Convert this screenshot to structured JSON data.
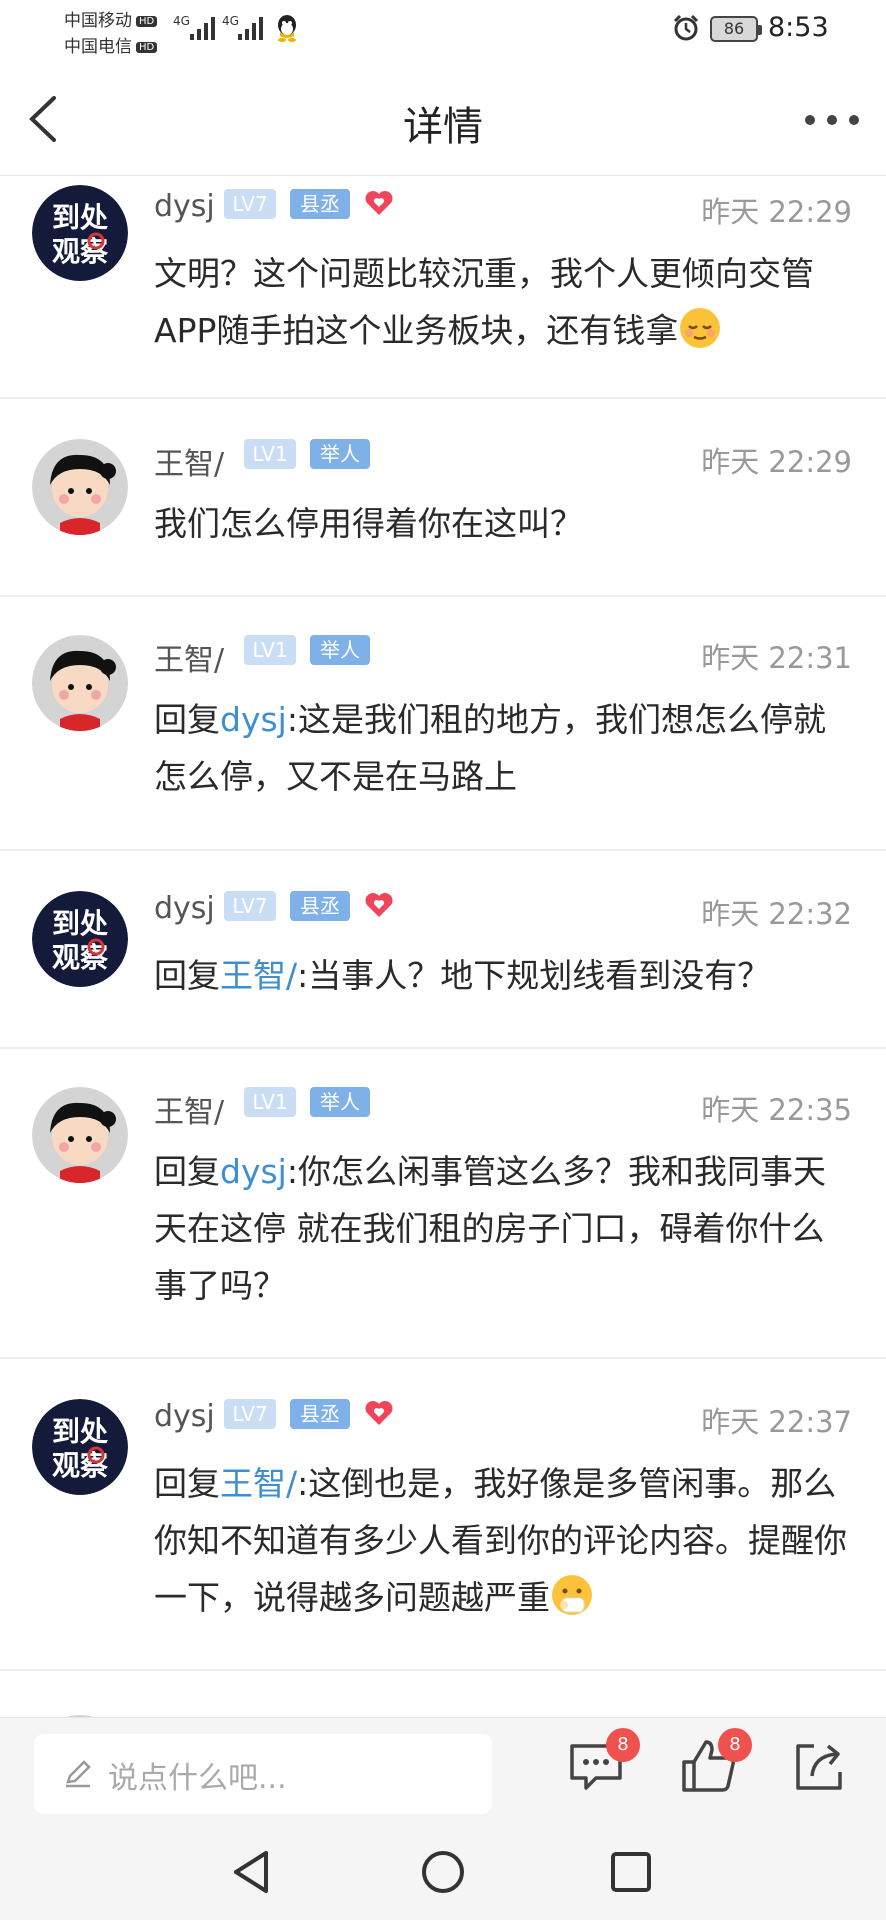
{
  "status": {
    "carrier1": "中国移动",
    "carrier2": "中国电信",
    "hd": "HD",
    "net1": "4G",
    "net2": "4G",
    "battery": "86",
    "time": "8:53"
  },
  "nav": {
    "title": "详情",
    "back_icon": "chevron-left-icon",
    "more_icon": "more-dots-icon"
  },
  "comments": [
    {
      "user": "dysj",
      "level": "LV7",
      "role": "县丞",
      "heart": true,
      "time": "昨天 22:29",
      "reply_prefix": "",
      "mention": "",
      "text": "文明？这个问题比较沉重，我个人更倾向交管APP随手拍这个业务板块，还有钱拿",
      "emoji": "relieved-face"
    },
    {
      "user": "王智/",
      "level": "LV1",
      "role": "举人",
      "heart": false,
      "time": "昨天 22:29",
      "reply_prefix": "",
      "mention": "",
      "text": "我们怎么停用得着你在这叫？",
      "emoji": ""
    },
    {
      "user": "王智/",
      "level": "LV1",
      "role": "举人",
      "heart": false,
      "time": "昨天 22:31",
      "reply_prefix": "回复",
      "mention": "dysj",
      "text": ":这是我们租的地方，我们想怎么停就怎么停，又不是在马路上",
      "emoji": ""
    },
    {
      "user": "dysj",
      "level": "LV7",
      "role": "县丞",
      "heart": true,
      "time": "昨天 22:32",
      "reply_prefix": "回复",
      "mention": "王智/",
      "text": ":当事人？地下规划线看到没有？",
      "emoji": ""
    },
    {
      "user": "王智/",
      "level": "LV1",
      "role": "举人",
      "heart": false,
      "time": "昨天 22:35",
      "reply_prefix": "回复",
      "mention": "dysj",
      "text": ":你怎么闲事管这么多？我和我同事天天在这停 就在我们租的房子门口，碍着你什么事了吗？",
      "emoji": ""
    },
    {
      "user": "dysj",
      "level": "LV7",
      "role": "县丞",
      "heart": true,
      "time": "昨天 22:37",
      "reply_prefix": "回复",
      "mention": "王智/",
      "text": ":这倒也是，我好像是多管闲事。那么你知不知道有多少人看到你的评论内容。提醒你一下，说得越多问题越严重",
      "emoji": "hush-face"
    }
  ],
  "bottom": {
    "placeholder": "说点什么吧...",
    "comment_count": "8",
    "like_count": "8"
  },
  "colors": {
    "mention": "#3d8fd1",
    "badge_level": "#c9ddf4",
    "badge_role": "#7fb0e8",
    "heart": "#f0445a",
    "notify": "#f0504e"
  }
}
